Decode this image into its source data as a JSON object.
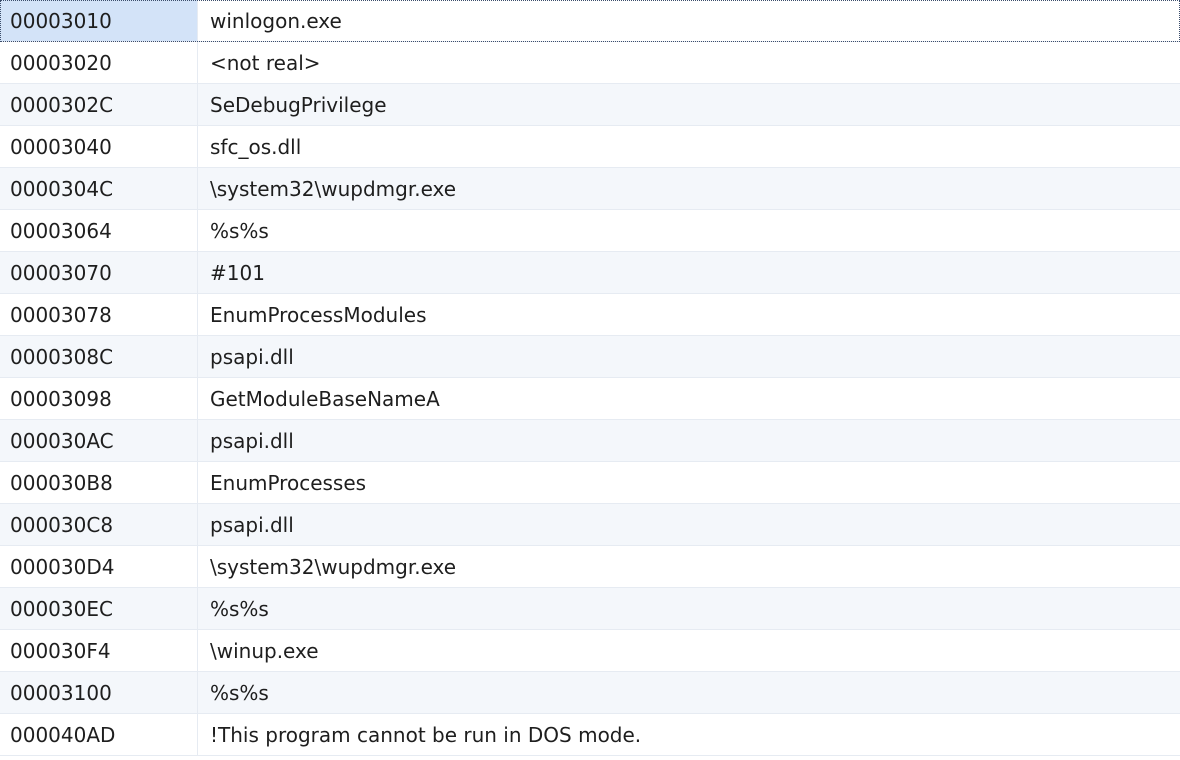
{
  "rows": [
    {
      "offset": "00003010",
      "string": "winlogon.exe"
    },
    {
      "offset": "00003020",
      "string": "<not real>"
    },
    {
      "offset": "0000302C",
      "string": "SeDebugPrivilege"
    },
    {
      "offset": "00003040",
      "string": "sfc_os.dll"
    },
    {
      "offset": "0000304C",
      "string": "\\system32\\wupdmgr.exe"
    },
    {
      "offset": "00003064",
      "string": "%s%s"
    },
    {
      "offset": "00003070",
      "string": "#101"
    },
    {
      "offset": "00003078",
      "string": "EnumProcessModules"
    },
    {
      "offset": "0000308C",
      "string": "psapi.dll"
    },
    {
      "offset": "00003098",
      "string": "GetModuleBaseNameA"
    },
    {
      "offset": "000030AC",
      "string": "psapi.dll"
    },
    {
      "offset": "000030B8",
      "string": "EnumProcesses"
    },
    {
      "offset": "000030C8",
      "string": "psapi.dll"
    },
    {
      "offset": "000030D4",
      "string": "\\system32\\wupdmgr.exe"
    },
    {
      "offset": "000030EC",
      "string": "%s%s"
    },
    {
      "offset": "000030F4",
      "string": "\\winup.exe"
    },
    {
      "offset": "00003100",
      "string": "%s%s"
    },
    {
      "offset": "000040AD",
      "string": "!This program cannot be run in DOS mode."
    }
  ]
}
